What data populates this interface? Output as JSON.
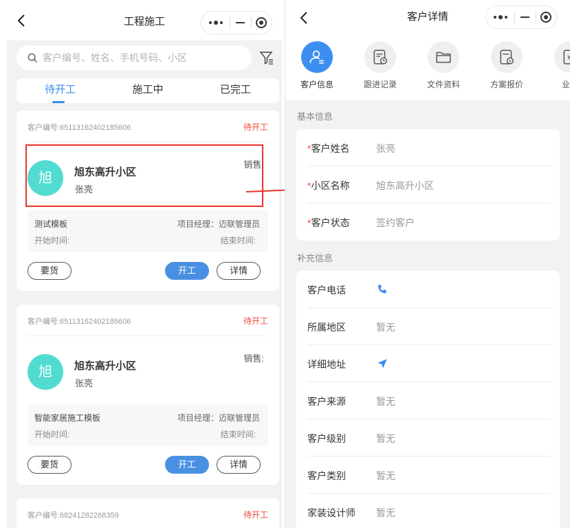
{
  "left": {
    "title": "工程施工",
    "search": {
      "placeholder": "客户编号、姓名、手机号码、小区",
      "value": ""
    },
    "tabs": [
      {
        "label": "待开工"
      },
      {
        "label": "施工中"
      },
      {
        "label": "已完工"
      }
    ],
    "cards": [
      {
        "customer_no": "客户编号:65113162402185606",
        "status": "待开工",
        "avatar_text": "旭",
        "project": "旭东高升小区",
        "customer": "张亮",
        "sales": "销售:",
        "template": "测试模板",
        "pm": "项目经理：迈联管理员",
        "start": "开始时间:",
        "end": "结束时间:",
        "btn_need": "要货",
        "btn_start": "开工",
        "btn_detail": "详情"
      },
      {
        "customer_no": "客户编号:65113162402185606",
        "status": "待开工",
        "avatar_text": "旭",
        "project": "旭东高升小区",
        "customer": "张亮",
        "sales": "销售:",
        "template": "智能家居施工模板",
        "pm": "项目经理：迈联管理员",
        "start": "开始时间:",
        "end": "结束时间:",
        "btn_need": "要货",
        "btn_start": "开工",
        "btn_detail": "详情"
      },
      {
        "customer_no": "客户编号:68241282268359",
        "status": "待开工"
      }
    ]
  },
  "right": {
    "title": "客户详情",
    "icon_tabs": [
      {
        "label": "客户信息",
        "icon": "customer-icon"
      },
      {
        "label": "跟进记录",
        "icon": "follow-record-icon"
      },
      {
        "label": "文件资料",
        "icon": "folder-icon"
      },
      {
        "label": "方案报价",
        "icon": "quote-icon"
      },
      {
        "label": "业务",
        "icon": "business-icon"
      }
    ],
    "basic": {
      "title": "基本信息",
      "fields": [
        {
          "label": "客户姓名",
          "value": "张亮",
          "required": "*"
        },
        {
          "label": "小区名称",
          "value": "旭东高升小区",
          "required": "*"
        },
        {
          "label": "客户状态",
          "value": "签约客户",
          "required": "*"
        }
      ]
    },
    "extra": {
      "title": "补充信息",
      "fields": [
        {
          "label": "客户电话",
          "icon": "phone-icon"
        },
        {
          "label": "所属地区",
          "value": "暂无"
        },
        {
          "label": "详细地址",
          "icon": "location-icon"
        },
        {
          "label": "客户来源",
          "value": "暂无"
        },
        {
          "label": "客户级别",
          "value": "暂无"
        },
        {
          "label": "客户类别",
          "value": "暂无"
        },
        {
          "label": "家装设计师",
          "value": "暂无"
        }
      ]
    }
  },
  "colors": {
    "accent": "#3b8ce8",
    "status_red": "#f04a3c",
    "avatar": "#52dcd1",
    "highlight": "#e8322b"
  }
}
